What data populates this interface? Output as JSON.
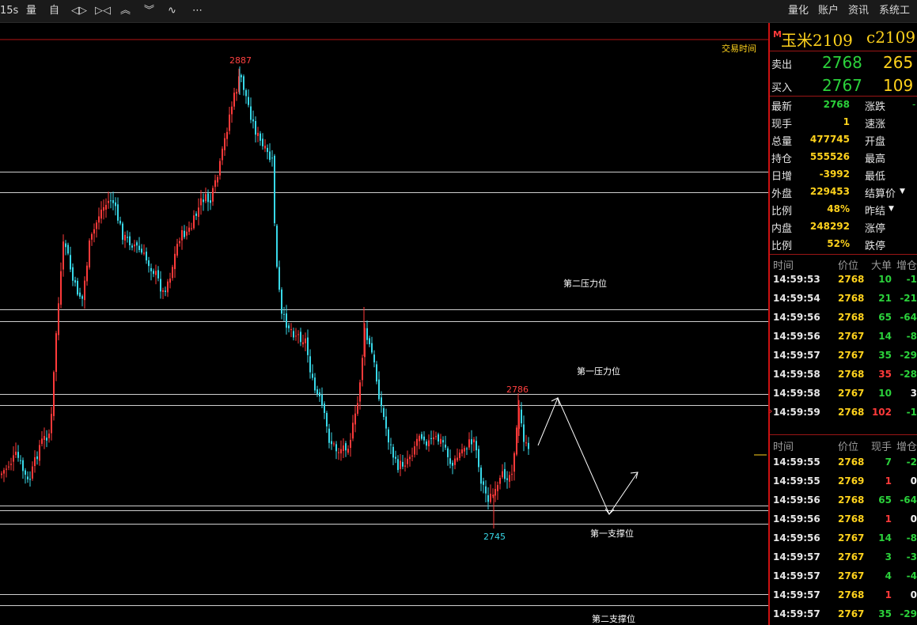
{
  "toolbar": {
    "left_items": [
      "15s",
      "量",
      "自",
      "◁▷",
      "▷◁",
      "︽",
      "︾",
      "∿",
      "⋯"
    ],
    "right_items": [
      "量化",
      "账户",
      "资讯",
      "系统工具"
    ]
  },
  "chart": {
    "time_label": "交易时间",
    "high_label": "2887",
    "mid_high_label": "2786",
    "low_label": "2745",
    "levels": {
      "r2": "第二压力位",
      "r1": "第一压力位",
      "s1": "第一支撑位",
      "s2": "第二支撑位"
    },
    "candle_colors": {
      "up": "#ff3a3a",
      "down": "#38d8e8"
    }
  },
  "quote": {
    "flag": "M",
    "name": "玉米2109",
    "code": "c2109",
    "ask_label": "卖出",
    "ask_price": "2768",
    "ask_vol": "265",
    "bid_label": "买入",
    "bid_price": "2767",
    "bid_vol": "109",
    "stats_left": [
      {
        "label": "最新",
        "value": "2768",
        "color": "green"
      },
      {
        "label": "现手",
        "value": "1",
        "color": "yellow"
      },
      {
        "label": "总量",
        "value": "477745",
        "color": "yellow"
      },
      {
        "label": "持仓",
        "value": "555526",
        "color": "yellow"
      },
      {
        "label": "日增",
        "value": "-3992",
        "color": "yellow"
      },
      {
        "label": "外盘",
        "value": "229453",
        "color": "yellow"
      },
      {
        "label": "比例",
        "value": "48%",
        "color": "yellow"
      },
      {
        "label": "内盘",
        "value": "248292",
        "color": "yellow"
      },
      {
        "label": "比例",
        "value": "52%",
        "color": "yellow"
      }
    ],
    "stats_right": [
      "涨跌",
      "速涨",
      "开盘",
      "最高",
      "最低",
      "结算价",
      "昨结",
      "涨停",
      "跌停"
    ],
    "stats_right_suffix": "-"
  },
  "trades_big": {
    "headers": [
      "时间",
      "价位",
      "大单",
      "增仓"
    ],
    "rows": [
      {
        "time": "14:59:53",
        "price": "2768",
        "vol": "10",
        "vol_color": "green",
        "chg": "-1"
      },
      {
        "time": "14:59:54",
        "price": "2768",
        "vol": "21",
        "vol_color": "green",
        "chg": "-21"
      },
      {
        "time": "14:59:56",
        "price": "2768",
        "vol": "65",
        "vol_color": "green",
        "chg": "-64"
      },
      {
        "time": "14:59:56",
        "price": "2767",
        "vol": "14",
        "vol_color": "green",
        "chg": "-8"
      },
      {
        "time": "14:59:57",
        "price": "2767",
        "vol": "35",
        "vol_color": "green",
        "chg": "-29"
      },
      {
        "time": "14:59:58",
        "price": "2768",
        "vol": "35",
        "vol_color": "red",
        "chg": "-28"
      },
      {
        "time": "14:59:58",
        "price": "2767",
        "vol": "10",
        "vol_color": "green",
        "chg": "3"
      },
      {
        "time": "14:59:59",
        "price": "2768",
        "vol": "102",
        "vol_color": "red",
        "chg": "-1"
      }
    ]
  },
  "trades_tick": {
    "headers": [
      "时间",
      "价位",
      "现手",
      "增仓"
    ],
    "rows": [
      {
        "time": "14:59:55",
        "price": "2768",
        "vol": "7",
        "vol_color": "green",
        "chg": "-2"
      },
      {
        "time": "14:59:55",
        "price": "2769",
        "vol": "1",
        "vol_color": "red",
        "chg": "0"
      },
      {
        "time": "14:59:56",
        "price": "2768",
        "vol": "65",
        "vol_color": "green",
        "chg": "-64"
      },
      {
        "time": "14:59:56",
        "price": "2768",
        "vol": "1",
        "vol_color": "red",
        "chg": "0"
      },
      {
        "time": "14:59:56",
        "price": "2767",
        "vol": "14",
        "vol_color": "green",
        "chg": "-8"
      },
      {
        "time": "14:59:57",
        "price": "2767",
        "vol": "3",
        "vol_color": "green",
        "chg": "-3"
      },
      {
        "time": "14:59:57",
        "price": "2767",
        "vol": "4",
        "vol_color": "green",
        "chg": "-4"
      },
      {
        "time": "14:59:57",
        "price": "2768",
        "vol": "1",
        "vol_color": "red",
        "chg": "0"
      },
      {
        "time": "14:59:57",
        "price": "2767",
        "vol": "35",
        "vol_color": "green",
        "chg": "-29"
      }
    ]
  }
}
